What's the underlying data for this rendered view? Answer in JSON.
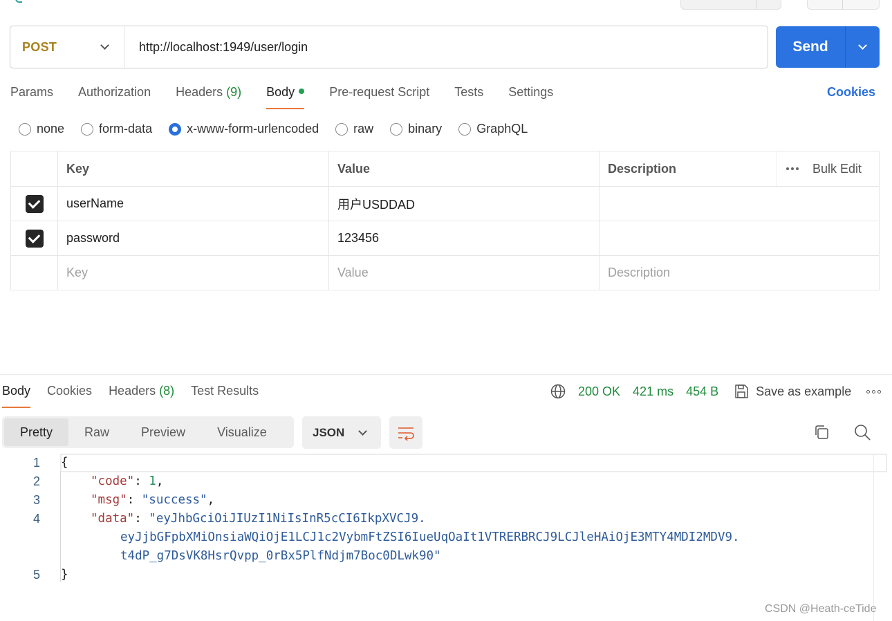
{
  "request": {
    "method": "POST",
    "url": "http://localhost:1949/user/login",
    "send_label": "Send"
  },
  "request_tabs": {
    "params": "Params",
    "authorization": "Authorization",
    "headers": "Headers",
    "headers_count": "(9)",
    "body": "Body",
    "pre_request": "Pre-request Script",
    "tests": "Tests",
    "settings": "Settings",
    "cookies": "Cookies"
  },
  "body_types": {
    "none": "none",
    "form_data": "form-data",
    "urlencoded": "x-www-form-urlencoded",
    "raw": "raw",
    "binary": "binary",
    "graphql": "GraphQL",
    "selected": "x-www-form-urlencoded"
  },
  "kv_table": {
    "headers": {
      "key": "Key",
      "value": "Value",
      "description": "Description",
      "bulk_edit": "Bulk Edit"
    },
    "rows": [
      {
        "key": "userName",
        "value": "用户USDDAD",
        "checked": true
      },
      {
        "key": "password",
        "value": "123456",
        "checked": true
      }
    ],
    "placeholders": {
      "key": "Key",
      "value": "Value",
      "description": "Description"
    }
  },
  "response": {
    "tabs": {
      "body": "Body",
      "cookies": "Cookies",
      "headers": "Headers",
      "headers_count": "(8)",
      "test_results": "Test Results"
    },
    "status": "200 OK",
    "time": "421 ms",
    "size": "454 B",
    "save_example": "Save as example",
    "views": {
      "pretty": "Pretty",
      "raw": "Raw",
      "preview": "Preview",
      "visualize": "Visualize"
    },
    "format": "JSON",
    "lines": {
      "n1": "1",
      "n2": "2",
      "n3": "3",
      "n4": "4",
      "n5": "5",
      "open": "{",
      "code_key": "\"code\"",
      "code_val": "1",
      "msg_key": "\"msg\"",
      "msg_val": "\"success\"",
      "data_key": "\"data\"",
      "data_val_1": "\"eyJhbGciOiJIUzI1NiIsInR5cCI6IkpXVCJ9.",
      "data_val_2": "eyJjbGFpbXMiOnsiaWQiOjE1LCJ1c2VybmFtZSI6IueUqOaIt1VTRERBRCJ9LCJleHAiOjE3MTY4MDI2MDV9.",
      "data_val_3": "t4dP_g7DsVK8HsrQvpp_0rBx5PlfNdjm7Boc0DLwk90\"",
      "close": "}"
    }
  },
  "watermark": "CSDN @Heath-ceTide",
  "colors": {
    "accent_orange": "#e8793a",
    "send_blue": "#2a73e0",
    "status_green": "#1f8a3b",
    "method_gold": "#a8811d"
  }
}
